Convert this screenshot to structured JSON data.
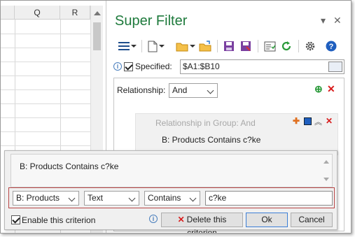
{
  "sheet": {
    "columns": [
      "Q",
      "R"
    ]
  },
  "pane": {
    "title": "Super Filter",
    "pin_glyph": "▾",
    "close_glyph": "✕",
    "toolbar_icons": [
      "menu-icon",
      "new-file-icon",
      "open-folder-icon",
      "open-recent-icon",
      "save-icon",
      "save-as-icon",
      "settings-scenario-icon",
      "refresh-icon",
      "gear-icon",
      "help-icon"
    ],
    "specified_label": "Specified:",
    "specified_checked": true,
    "range_value": "$A1:$B10",
    "relationship_label": "Relationship:",
    "relationship_value": "And",
    "group": {
      "title": "Relationship in Group:   And",
      "criterion": "B: Products  Contains  c?ke"
    }
  },
  "dialog": {
    "preview_text": "B: Products  Contains  c?ke",
    "column_value": "B: Products",
    "type_value": "Text",
    "operator_value": "Contains",
    "criterion_value": "c?ke",
    "enable_label": "Enable this criterion",
    "enable_checked": true,
    "delete_label": "Delete this criterion",
    "ok_label": "Ok",
    "cancel_label": "Cancel"
  },
  "colors": {
    "title_green": "#1e7a3c",
    "delete_red": "#d81b1b",
    "add_green": "#2a9a3a",
    "highlight_border": "#b84545"
  }
}
